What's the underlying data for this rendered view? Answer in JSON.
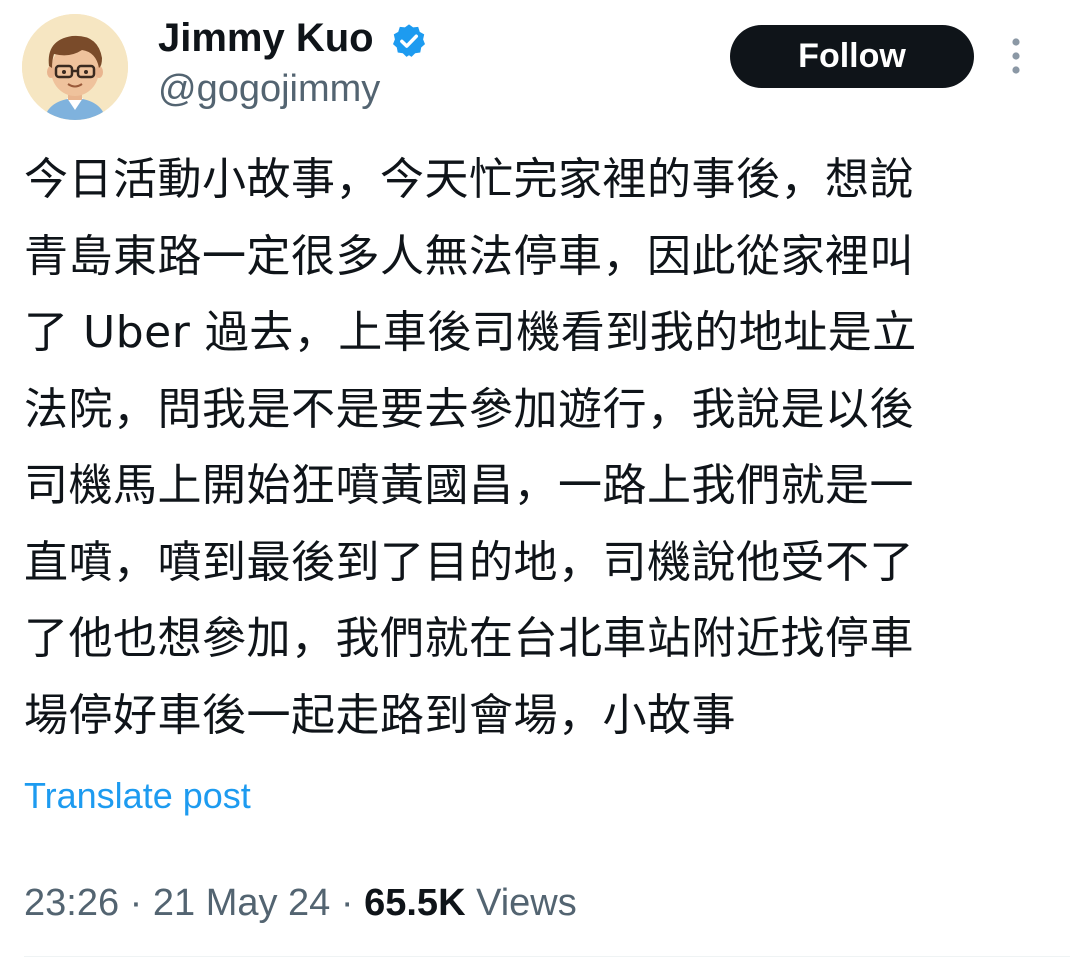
{
  "author": {
    "display_name": "Jimmy Kuo",
    "handle": "@gogojimmy",
    "verified": true
  },
  "actions": {
    "follow_label": "Follow",
    "more_icon": "more-vertical-icon"
  },
  "tweet": {
    "lines": [
      "今日活動小故事，今天忙完家裡的事後，想說",
      "青島東路一定很多人無法停車，因此從家裡叫",
      "了 Uber 過去，上車後司機看到我的地址是立",
      "法院，問我是不是要去參加遊行，我說是以後",
      "司機馬上開始狂噴黃國昌，一路上我們就是一",
      "直噴，噴到最後到了目的地，司機說他受不了",
      "了他也想參加，我們就在台北車站附近找停車",
      "場停好車後一起走路到會場，小故事"
    ],
    "translate_label": "Translate post"
  },
  "meta": {
    "time": "23:26",
    "sep1": " · ",
    "date": "21 May 24",
    "sep2": " · ",
    "views_count": "65.5K",
    "views_label": " Views"
  },
  "colors": {
    "text": "#0f1419",
    "secondary": "#536471",
    "link": "#1d9bf0",
    "verified": "#1d9bf0",
    "button_bg": "#0f1419"
  }
}
